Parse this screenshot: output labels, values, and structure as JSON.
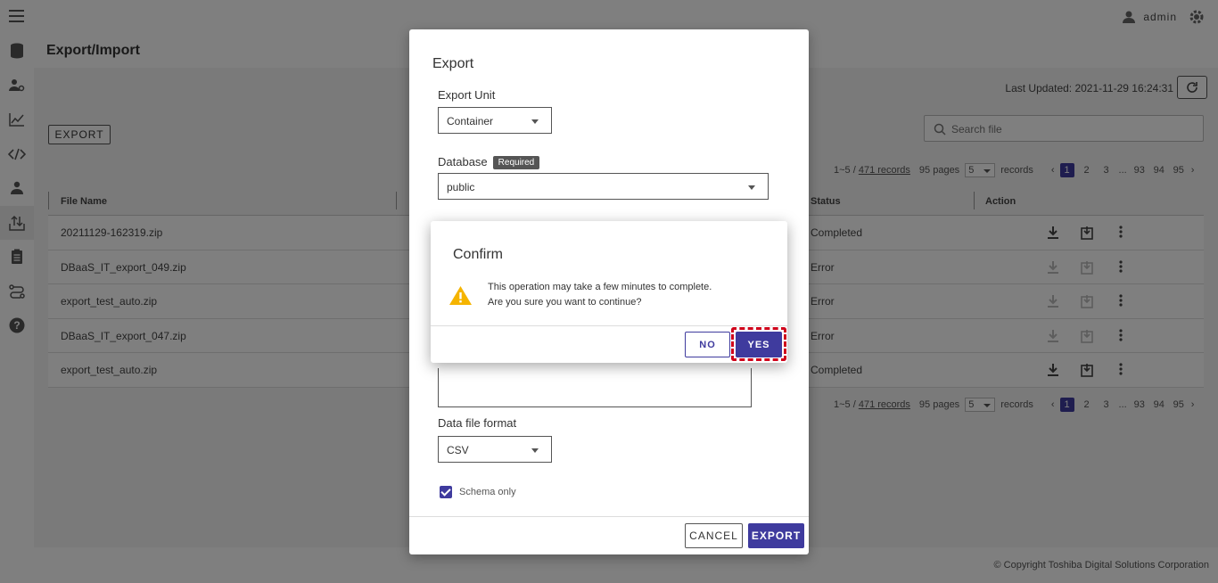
{
  "header": {
    "user_name": "admin"
  },
  "page": {
    "title": "Export/Import"
  },
  "toolbar": {
    "export_label": "EXPORT",
    "last_updated": "Last Updated: 2021-11-29 16:24:31",
    "search_placeholder": "Search file"
  },
  "pager": {
    "range": "1~5 / ",
    "records": "471 records",
    "pages": "95 pages",
    "per_page": "5",
    "records_word": "records",
    "page_buttons": [
      "1",
      "2",
      "3",
      "...",
      "93",
      "94",
      "95"
    ]
  },
  "table": {
    "columns": [
      "File Name",
      "Status",
      "Action"
    ],
    "rows": [
      {
        "file": "20211129-162319.zip",
        "status": "Completed"
      },
      {
        "file": "DBaaS_IT_export_049.zip",
        "status": "Error"
      },
      {
        "file": "export_test_auto.zip",
        "status": "Error"
      },
      {
        "file": "DBaaS_IT_export_047.zip",
        "status": "Error"
      },
      {
        "file": "export_test_auto.zip",
        "status": "Completed"
      }
    ]
  },
  "footer": {
    "copyright": "© Copyright Toshiba Digital Solutions Corporation"
  },
  "export_dialog": {
    "title": "Export",
    "unit_label": "Export Unit",
    "unit_value": "Container",
    "db_label": "Database",
    "required_badge": "Required",
    "db_value": "public",
    "format_label": "Data file format",
    "format_value": "CSV",
    "schema_only": "Schema only",
    "cancel": "CANCEL",
    "export": "EXPORT"
  },
  "confirm": {
    "title": "Confirm",
    "line1": "This operation may take a few minutes to complete.",
    "line2": "Are you sure you want to continue?",
    "no": "NO",
    "yes": "YES"
  },
  "colors": {
    "primary": "#3f3b9e",
    "highlight": "#d0021b",
    "warning": "#f5b400"
  }
}
